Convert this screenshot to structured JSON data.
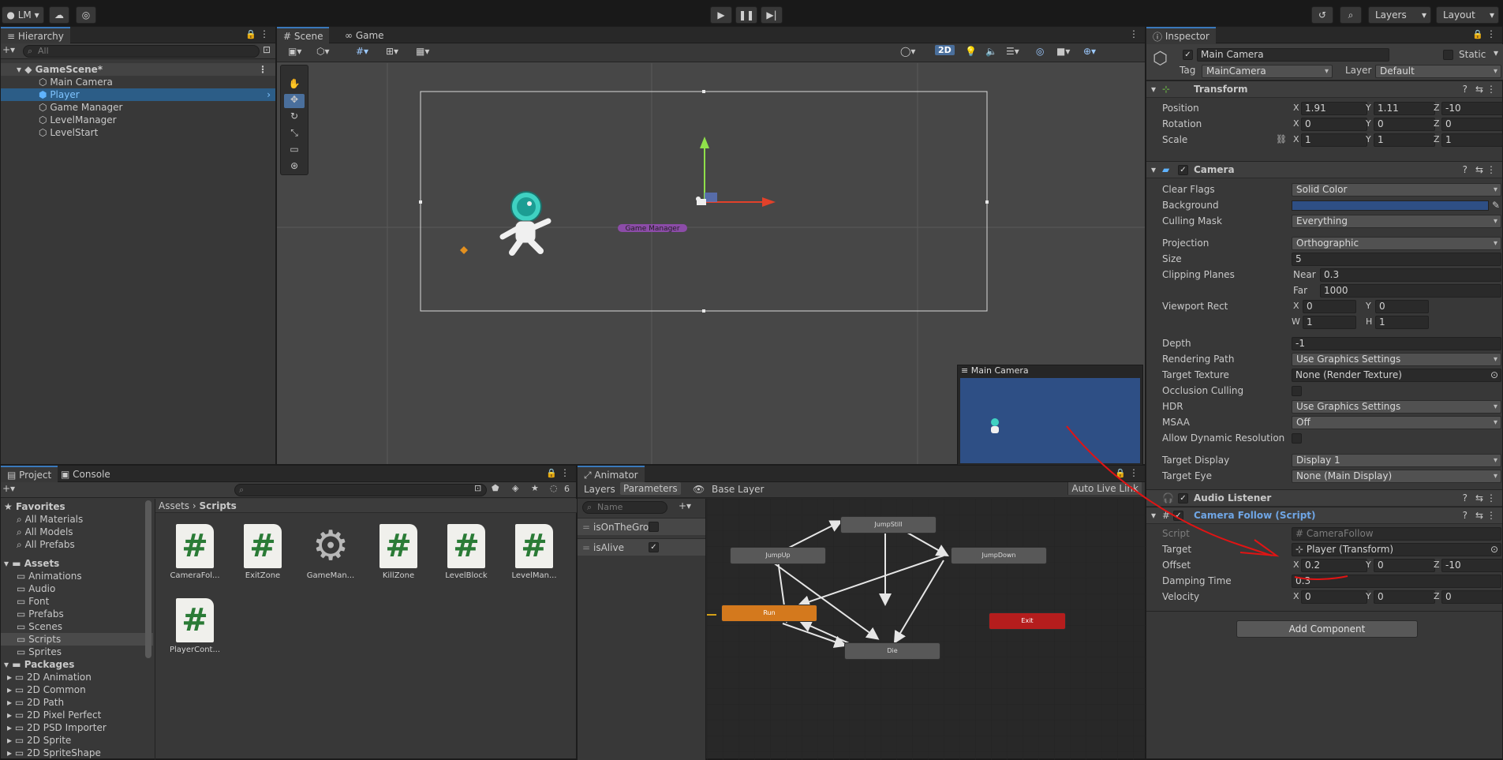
{
  "toolbar": {
    "account": "LM",
    "layers": "Layers",
    "layout": "Layout"
  },
  "hierarchy": {
    "tab": "Hierarchy",
    "search_placeholder": "All",
    "scene": "GameScene*",
    "items": [
      "Main Camera",
      "Player",
      "Game Manager",
      "LevelManager",
      "LevelStart"
    ]
  },
  "scene": {
    "tabs": [
      "Scene",
      "Game"
    ],
    "mode_2d": "2D",
    "game_manager_label": "Game Manager",
    "camera_preview_title": "Main Camera"
  },
  "project": {
    "tabs": [
      "Project",
      "Console"
    ],
    "hidden_count": "6",
    "favorites_title": "Favorites",
    "favorites": [
      "All Materials",
      "All Models",
      "All Prefabs"
    ],
    "assets_title": "Assets",
    "asset_folders": [
      "Animations",
      "Audio",
      "Font",
      "Prefabs",
      "Scenes",
      "Scripts",
      "Sprites"
    ],
    "packages_title": "Packages",
    "packages": [
      "2D Animation",
      "2D Common",
      "2D Path",
      "2D Pixel Perfect",
      "2D PSD Importer",
      "2D Sprite",
      "2D SpriteShape"
    ],
    "breadcrumb": [
      "Assets",
      "Scripts"
    ],
    "files": [
      "CameraFol...",
      "ExitZone",
      "GameMan...",
      "KillZone",
      "LevelBlock",
      "LevelMan...",
      "PlayerCont..."
    ]
  },
  "animator": {
    "tab": "Animator",
    "subtabs": [
      "Layers",
      "Parameters"
    ],
    "base_layer": "Base Layer",
    "auto_live_link": "Auto Live Link",
    "search_placeholder": "Name",
    "params": [
      {
        "name": "isOnTheGro",
        "checked": false
      },
      {
        "name": "isAlive",
        "checked": true
      }
    ],
    "states": [
      "JumpStill",
      "JumpUp",
      "JumpDown",
      "Run",
      "Die",
      "Exit"
    ]
  },
  "inspector": {
    "tab": "Inspector",
    "object_name": "Main Camera",
    "static_label": "Static",
    "tag_label": "Tag",
    "tag_value": "MainCamera",
    "layer_label": "Layer",
    "layer_value": "Default",
    "transform": {
      "title": "Transform",
      "position": {
        "label": "Position",
        "x": "1.91",
        "y": "1.11",
        "z": "-10"
      },
      "rotation": {
        "label": "Rotation",
        "x": "0",
        "y": "0",
        "z": "0"
      },
      "scale": {
        "label": "Scale",
        "x": "1",
        "y": "1",
        "z": "1"
      }
    },
    "camera": {
      "title": "Camera",
      "clear_flags": {
        "label": "Clear Flags",
        "value": "Solid Color"
      },
      "background": {
        "label": "Background",
        "color": "#2e4f85"
      },
      "culling_mask": {
        "label": "Culling Mask",
        "value": "Everything"
      },
      "projection": {
        "label": "Projection",
        "value": "Orthographic"
      },
      "size": {
        "label": "Size",
        "value": "5"
      },
      "clipping": {
        "label": "Clipping Planes",
        "near_label": "Near",
        "near": "0.3",
        "far_label": "Far",
        "far": "1000"
      },
      "viewport": {
        "label": "Viewport Rect",
        "x": "0",
        "y": "0",
        "w": "1",
        "h": "1"
      },
      "depth": {
        "label": "Depth",
        "value": "-1"
      },
      "rendering_path": {
        "label": "Rendering Path",
        "value": "Use Graphics Settings"
      },
      "target_texture": {
        "label": "Target Texture",
        "value": "None (Render Texture)"
      },
      "occlusion": {
        "label": "Occlusion Culling"
      },
      "hdr": {
        "label": "HDR",
        "value": "Use Graphics Settings"
      },
      "msaa": {
        "label": "MSAA",
        "value": "Off"
      },
      "dynamic_res": {
        "label": "Allow Dynamic Resolution"
      },
      "target_display": {
        "label": "Target Display",
        "value": "Display 1"
      },
      "target_eye": {
        "label": "Target Eye",
        "value": "None (Main Display)"
      }
    },
    "audio_listener": {
      "title": "Audio Listener"
    },
    "camera_follow": {
      "title": "Camera Follow (Script)",
      "script": {
        "label": "Script",
        "value": "CameraFollow"
      },
      "target": {
        "label": "Target",
        "value": "Player (Transform)"
      },
      "offset": {
        "label": "Offset",
        "x": "0.2",
        "y": "0",
        "z": "-10"
      },
      "damping": {
        "label": "Damping Time",
        "value": "0.3"
      },
      "velocity": {
        "label": "Velocity",
        "x": "0",
        "y": "0",
        "z": "0"
      }
    },
    "add_component": "Add Component"
  },
  "axis_labels": {
    "x": "X",
    "y": "Y",
    "z": "Z",
    "w": "W",
    "h": "H"
  },
  "colors": {
    "accent": "#3a79bb",
    "annotation": "#e01414",
    "run_state": "#d4791d",
    "exit_state": "#b51d1d"
  }
}
